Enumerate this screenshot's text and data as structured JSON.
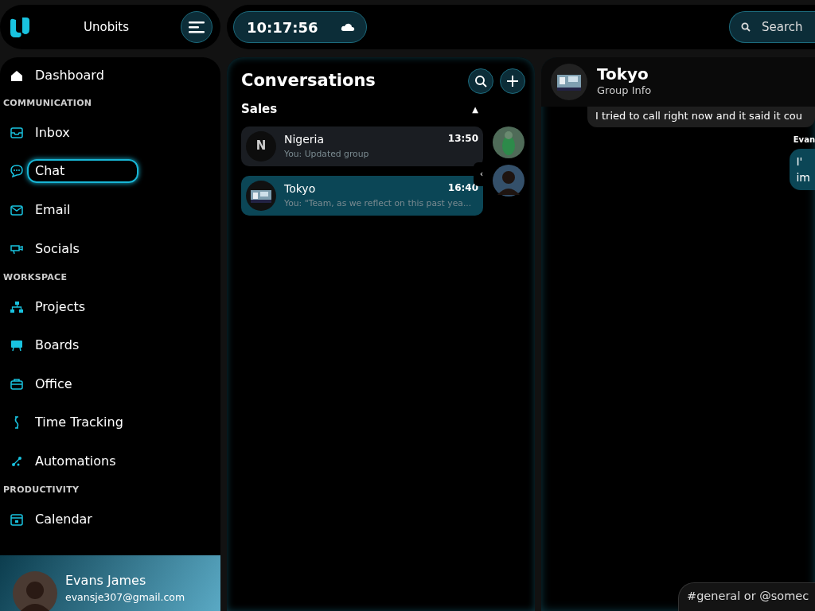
{
  "brand": {
    "name": "Unobits"
  },
  "clock": {
    "time": "10:17:56"
  },
  "search": {
    "placeholder": "Search"
  },
  "sidebar": {
    "items": [
      {
        "kind": "item",
        "label": "Dashboard",
        "selected": false
      },
      {
        "kind": "section",
        "label": "COMMUNICATION"
      },
      {
        "kind": "item",
        "label": "Inbox",
        "selected": false
      },
      {
        "kind": "item",
        "label": "Chat",
        "selected": true
      },
      {
        "kind": "item",
        "label": "Email",
        "selected": false
      },
      {
        "kind": "item",
        "label": "Socials",
        "selected": false
      },
      {
        "kind": "section",
        "label": "WORKSPACE"
      },
      {
        "kind": "item",
        "label": "Projects",
        "selected": false
      },
      {
        "kind": "item",
        "label": "Boards",
        "selected": false
      },
      {
        "kind": "item",
        "label": "Office",
        "selected": false
      },
      {
        "kind": "item",
        "label": "Time Tracking",
        "selected": false
      },
      {
        "kind": "item",
        "label": "Automations",
        "selected": false
      },
      {
        "kind": "section",
        "label": "PRODUCTIVITY"
      },
      {
        "kind": "item",
        "label": "Calendar",
        "selected": false
      }
    ]
  },
  "user": {
    "name": "Evans James",
    "email": "evansje307@gmail.com"
  },
  "conversations": {
    "title": "Conversations",
    "group": {
      "label": "Sales",
      "caret": "▲",
      "expanded": true
    },
    "collapse": "‹",
    "items": [
      {
        "kind": "letter",
        "initial": "N",
        "name": "Nigeria",
        "time": "13:50",
        "preview": "You: Updated group",
        "selected": false
      },
      {
        "kind": "picture",
        "name": "Tokyo",
        "time": "16:40",
        "preview": "You: \"Team, as we reflect on this past yea...",
        "selected": true
      }
    ]
  },
  "chat": {
    "title": "Tokyo",
    "subtitle": "Group Info",
    "messages": [
      {
        "kind": "incoming",
        "text": "I tried to call right now and it said it cou"
      },
      {
        "kind": "outgoing",
        "sender": "Evan",
        "text": "I'\nim"
      }
    ],
    "composer": {
      "placeholder": "#general or @somec"
    }
  }
}
